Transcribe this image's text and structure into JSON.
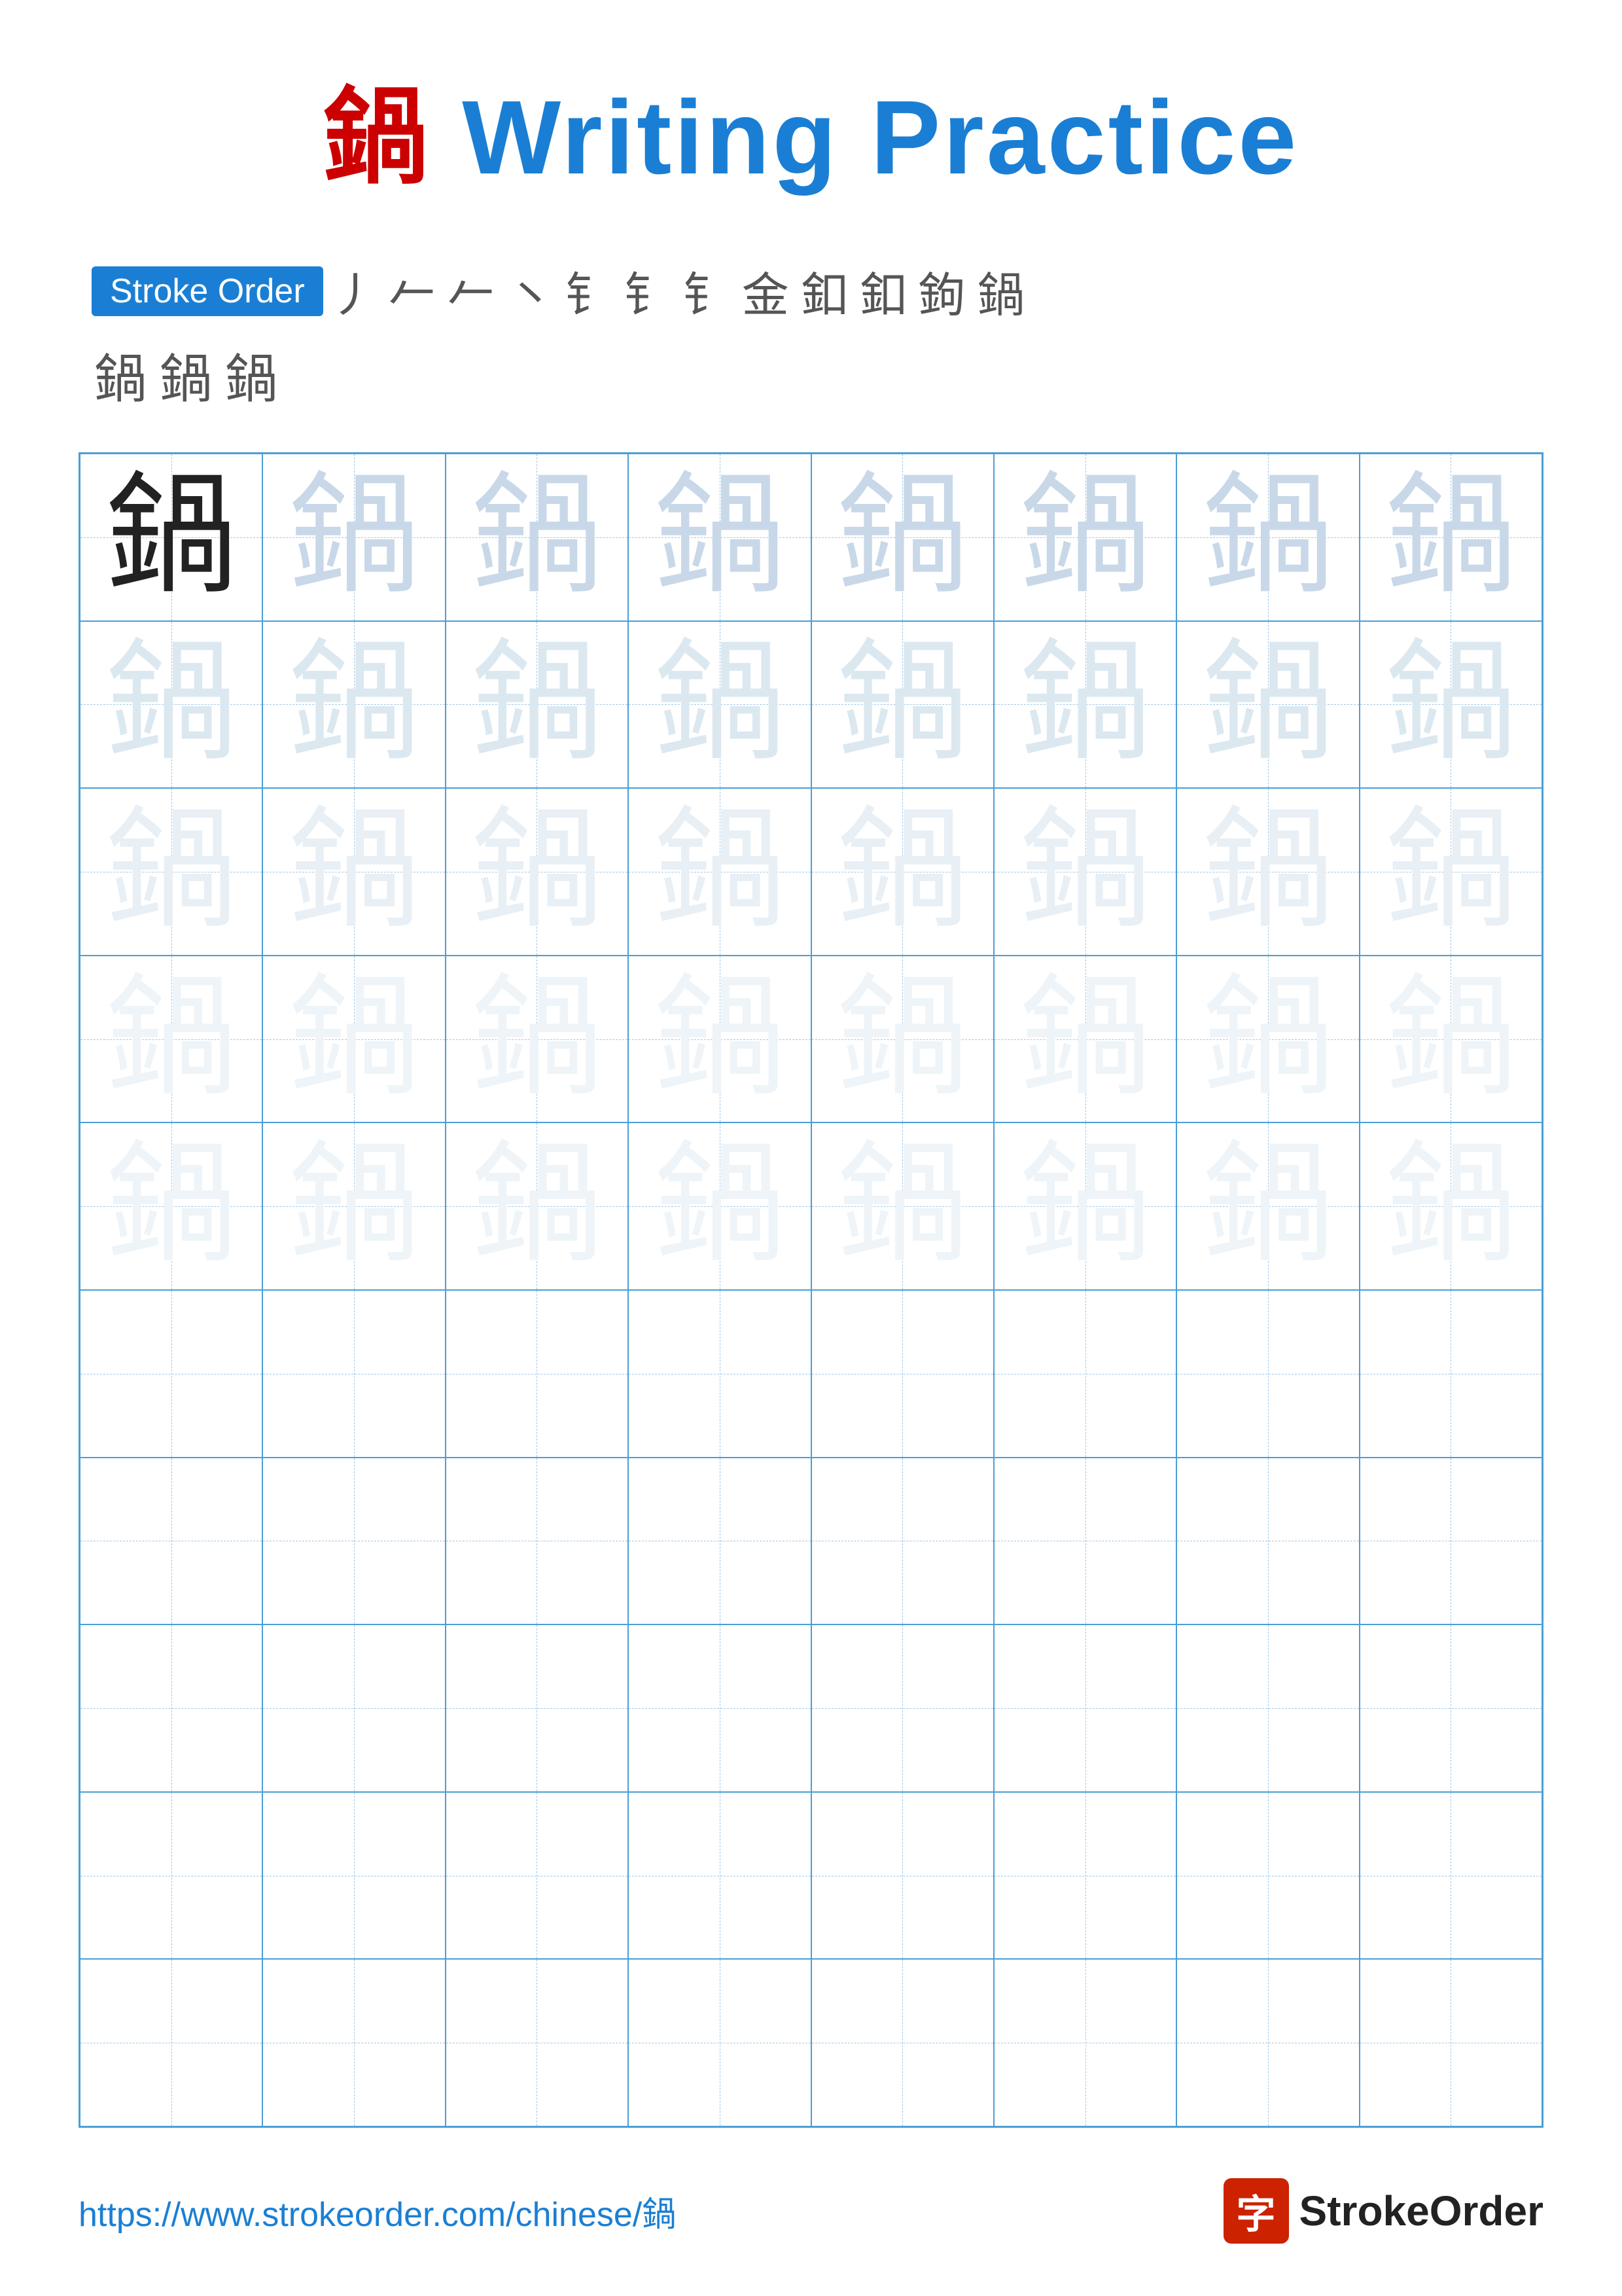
{
  "title": {
    "char": "鍋",
    "text": " Writing Practice"
  },
  "stroke_order": {
    "badge_label": "Stroke Order",
    "strokes": [
      "丿",
      "ㄥ",
      "𠂉",
      "㇔",
      "钅",
      "钅",
      "钅",
      "金",
      "鈥",
      "鈥",
      "鉤",
      "鍋"
    ],
    "row2_chars": [
      "鍋",
      "鍋",
      "鍋"
    ]
  },
  "grid": {
    "rows": 10,
    "cols": 8,
    "char": "鍋",
    "shading": [
      [
        "dark",
        "medium",
        "medium",
        "medium",
        "medium",
        "medium",
        "medium",
        "medium"
      ],
      [
        "light",
        "light",
        "light",
        "light",
        "light",
        "light",
        "light",
        "light"
      ],
      [
        "lighter",
        "lighter",
        "lighter",
        "lighter",
        "lighter",
        "lighter",
        "lighter",
        "lighter"
      ],
      [
        "lightest",
        "lightest",
        "lightest",
        "lightest",
        "lightest",
        "lightest",
        "lightest",
        "lightest"
      ],
      [
        "lightest",
        "lightest",
        "lightest",
        "lightest",
        "lightest",
        "lightest",
        "lightest",
        "lightest"
      ],
      [
        "empty",
        "empty",
        "empty",
        "empty",
        "empty",
        "empty",
        "empty",
        "empty"
      ],
      [
        "empty",
        "empty",
        "empty",
        "empty",
        "empty",
        "empty",
        "empty",
        "empty"
      ],
      [
        "empty",
        "empty",
        "empty",
        "empty",
        "empty",
        "empty",
        "empty",
        "empty"
      ],
      [
        "empty",
        "empty",
        "empty",
        "empty",
        "empty",
        "empty",
        "empty",
        "empty"
      ],
      [
        "empty",
        "empty",
        "empty",
        "empty",
        "empty",
        "empty",
        "empty",
        "empty"
      ]
    ]
  },
  "footer": {
    "url": "https://www.strokeorder.com/chinese/鍋",
    "logo_char": "字",
    "logo_text": "StrokeOrder"
  }
}
